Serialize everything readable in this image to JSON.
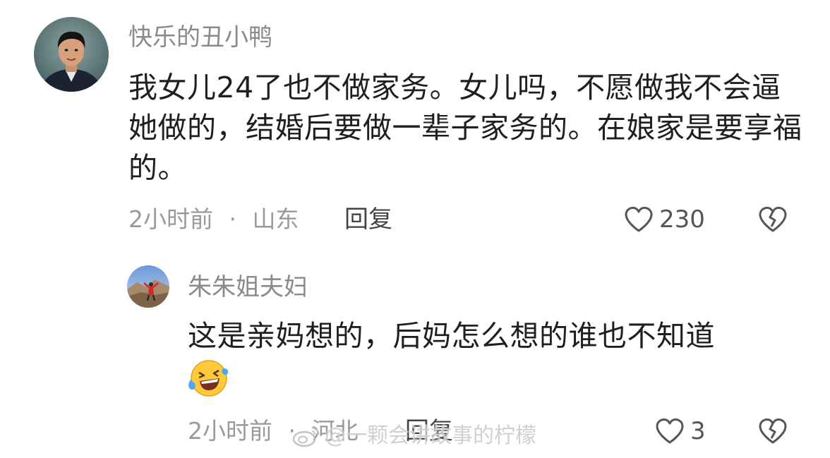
{
  "comments": {
    "main": {
      "username": "快乐的丑小鸭",
      "text": "我女儿24了也不做家务。女儿吗，不愿做我不会逼她做的，结婚后要做一辈子家务的。在娘家是要享福的。",
      "time": "2小时前",
      "separator": "·",
      "location": "山东",
      "reply_label": "回复",
      "likes": "230",
      "avatar_icon": "user-avatar-photo"
    },
    "reply": {
      "username": "朱朱姐夫妇",
      "text": "这是亲妈想的，后妈怎么想的谁也不知道",
      "emoji_icon": "laughing-with-tears-emoji",
      "time": "2小时前",
      "separator": "·",
      "location": "河北",
      "reply_label": "回复",
      "likes": "3",
      "avatar_icon": "user-avatar-photo"
    }
  },
  "watermark": {
    "text": "@一颗会讲故事的柠檬",
    "icon": "weibo-logo-icon"
  },
  "colors": {
    "text": "#1f1f1f",
    "muted": "#8a8a8a",
    "icon": "#555555"
  }
}
